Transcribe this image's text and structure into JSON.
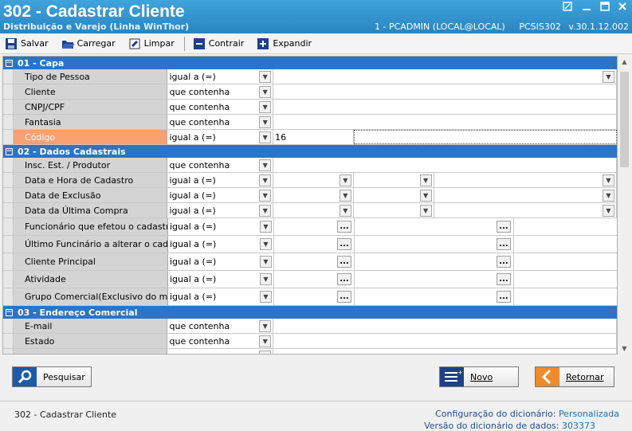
{
  "window": {
    "title": "302 - Cadastrar Cliente",
    "subtitle": "Distribuição e Varejo (Linha WinThor)",
    "user_info": "1 - PCADMIN (LOCAL@LOCAL)",
    "program": "PCSIS302",
    "version": "v.30.1.12.002"
  },
  "toolbar": {
    "save": "Salvar",
    "load": "Carregar",
    "clear": "Limpar",
    "collapse": "Contrair",
    "expand": "Expandir"
  },
  "sections": [
    {
      "toggle": "−",
      "title": "01 - Capa"
    },
    {
      "toggle": "−",
      "title": "02 - Dados Cadastrais"
    },
    {
      "toggle": "−",
      "title": "03 - Endereço Comercial"
    }
  ],
  "rows": {
    "tipo_pessoa": {
      "label": "Tipo de Pessoa",
      "op": "igual a (=)"
    },
    "cliente": {
      "label": "Cliente",
      "op": "que contenha"
    },
    "cnpj": {
      "label": "CNPJ/CPF",
      "op": "que contenha"
    },
    "fantasia": {
      "label": "Fantasia",
      "op": "que contenha"
    },
    "codigo": {
      "label": "Código",
      "op": "igual a (=)",
      "value": "16"
    },
    "insc": {
      "label": "Insc. Est. / Produtor",
      "op": "que contenha"
    },
    "data_cadastro": {
      "label": "Data e Hora de Cadastro",
      "op": "igual a (=)"
    },
    "data_exclusao": {
      "label": "Data de Exclusão",
      "op": "igual a (=)"
    },
    "data_ultima_compra": {
      "label": "Data da Última Compra",
      "op": "igual a (=)"
    },
    "func_cadastro": {
      "label": "Funcionário que efetou o cadastro",
      "op": "igual a (=)"
    },
    "ultimo_func": {
      "label": "Último Funcinário a alterar o cadastro",
      "op": "igual a (=)"
    },
    "cliente_principal": {
      "label": "Cliente Principal",
      "op": "igual a (=)"
    },
    "atividade": {
      "label": "Atividade",
      "op": "igual a (=)"
    },
    "grupo_comercial": {
      "label": "Grupo Comercial(Exclusivo do modulo",
      "op": "igual a (=)"
    },
    "email": {
      "label": "E-mail",
      "op": "que contenha"
    },
    "estado": {
      "label": "Estado",
      "op": "que contenha"
    }
  },
  "buttons": {
    "search": "Pesquisar",
    "new": "Novo",
    "return": "Retornar"
  },
  "status": {
    "screen": "302 - Cadastrar Cliente",
    "dict_config_label": "Configuração do dicionário:",
    "dict_config_value": "Personalizada",
    "dict_version_label": "Versão do dicionário de dados:",
    "dict_version_value": "303373"
  },
  "colors": {
    "titlebar": "#2f8fc9",
    "section": "#2d73c6",
    "selected_label": "#f7a070"
  }
}
